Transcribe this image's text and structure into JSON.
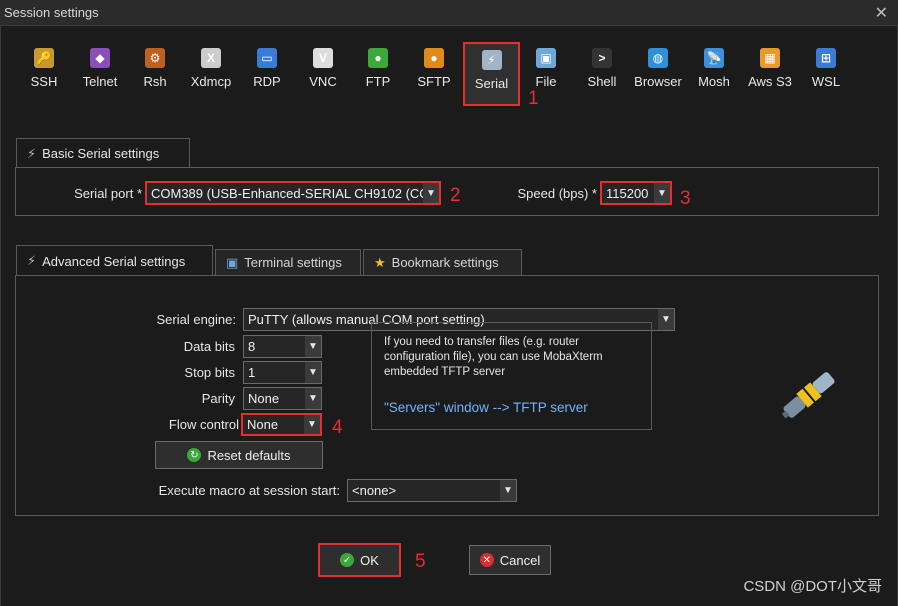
{
  "window": {
    "title": "Session settings"
  },
  "protocols": [
    {
      "label": "SSH",
      "icon": "ssh-key-icon",
      "color": "#c79a2e",
      "glyph": "🔑"
    },
    {
      "label": "Telnet",
      "icon": "telnet-icon",
      "color": "#8a4fb8",
      "glyph": "◆"
    },
    {
      "label": "Rsh",
      "icon": "rsh-icon",
      "color": "#c0601f",
      "glyph": "⚙"
    },
    {
      "label": "Xdmcp",
      "icon": "xdmcp-icon",
      "color": "#cccccc",
      "glyph": "X"
    },
    {
      "label": "RDP",
      "icon": "rdp-icon",
      "color": "#3b7bd6",
      "glyph": "▭"
    },
    {
      "label": "VNC",
      "icon": "vnc-icon",
      "color": "#dddddd",
      "glyph": "V"
    },
    {
      "label": "FTP",
      "icon": "ftp-icon",
      "color": "#3aa83a",
      "glyph": "●"
    },
    {
      "label": "SFTP",
      "icon": "sftp-icon",
      "color": "#e08a1a",
      "glyph": "●"
    },
    {
      "label": "Serial",
      "icon": "serial-plug-icon",
      "color": "#9fb6c8",
      "glyph": "⚡"
    },
    {
      "label": "File",
      "icon": "file-icon",
      "color": "#6fa8d8",
      "glyph": "▣"
    },
    {
      "label": "Shell",
      "icon": "shell-icon",
      "color": "#333333",
      "glyph": ">"
    },
    {
      "label": "Browser",
      "icon": "browser-globe-icon",
      "color": "#2f8fd8",
      "glyph": "◍"
    },
    {
      "label": "Mosh",
      "icon": "mosh-antenna-icon",
      "color": "#3b8fe0",
      "glyph": "📡"
    },
    {
      "label": "Aws S3",
      "icon": "aws-s3-icon",
      "color": "#e89a2a",
      "glyph": "▦"
    },
    {
      "label": "WSL",
      "icon": "wsl-windows-icon",
      "color": "#3b7bd6",
      "glyph": "⊞"
    }
  ],
  "annotations": [
    "1",
    "2",
    "3",
    "4",
    "5"
  ],
  "basic": {
    "tab_label": "Basic Serial settings",
    "serial_port_label": "Serial port *",
    "serial_port_value": "COM389  (USB-Enhanced-SERIAL CH9102 (CO",
    "speed_label": "Speed (bps) *",
    "speed_value": "115200"
  },
  "advanced_tabs": [
    {
      "label": "Advanced Serial settings",
      "icon": "serial-plug-icon"
    },
    {
      "label": "Terminal settings",
      "icon": "terminal-settings-icon"
    },
    {
      "label": "Bookmark settings",
      "icon": "star-icon"
    }
  ],
  "advanced": {
    "engine_label": "Serial engine:",
    "engine_value": "PuTTY    (allows manual COM port setting)",
    "data_bits_label": "Data bits",
    "data_bits_value": "8",
    "stop_bits_label": "Stop bits",
    "stop_bits_value": "1",
    "parity_label": "Parity",
    "parity_value": "None",
    "flow_label": "Flow control",
    "flow_value": "None",
    "reset_label": "Reset defaults",
    "macro_label": "Execute macro at session start:",
    "macro_value": "<none>",
    "info_text": "If you need to transfer files (e.g. router configuration file), you can use MobaXterm embedded TFTP server",
    "info_link": "\"Servers\" window  -->  TFTP server"
  },
  "buttons": {
    "ok": "OK",
    "cancel": "Cancel"
  },
  "watermark": "CSDN @DOT小文哥",
  "colors": {
    "highlight": "#e03030",
    "link": "#6fb3ff",
    "ok_green": "#3aa83a",
    "cancel_red": "#d83030"
  }
}
